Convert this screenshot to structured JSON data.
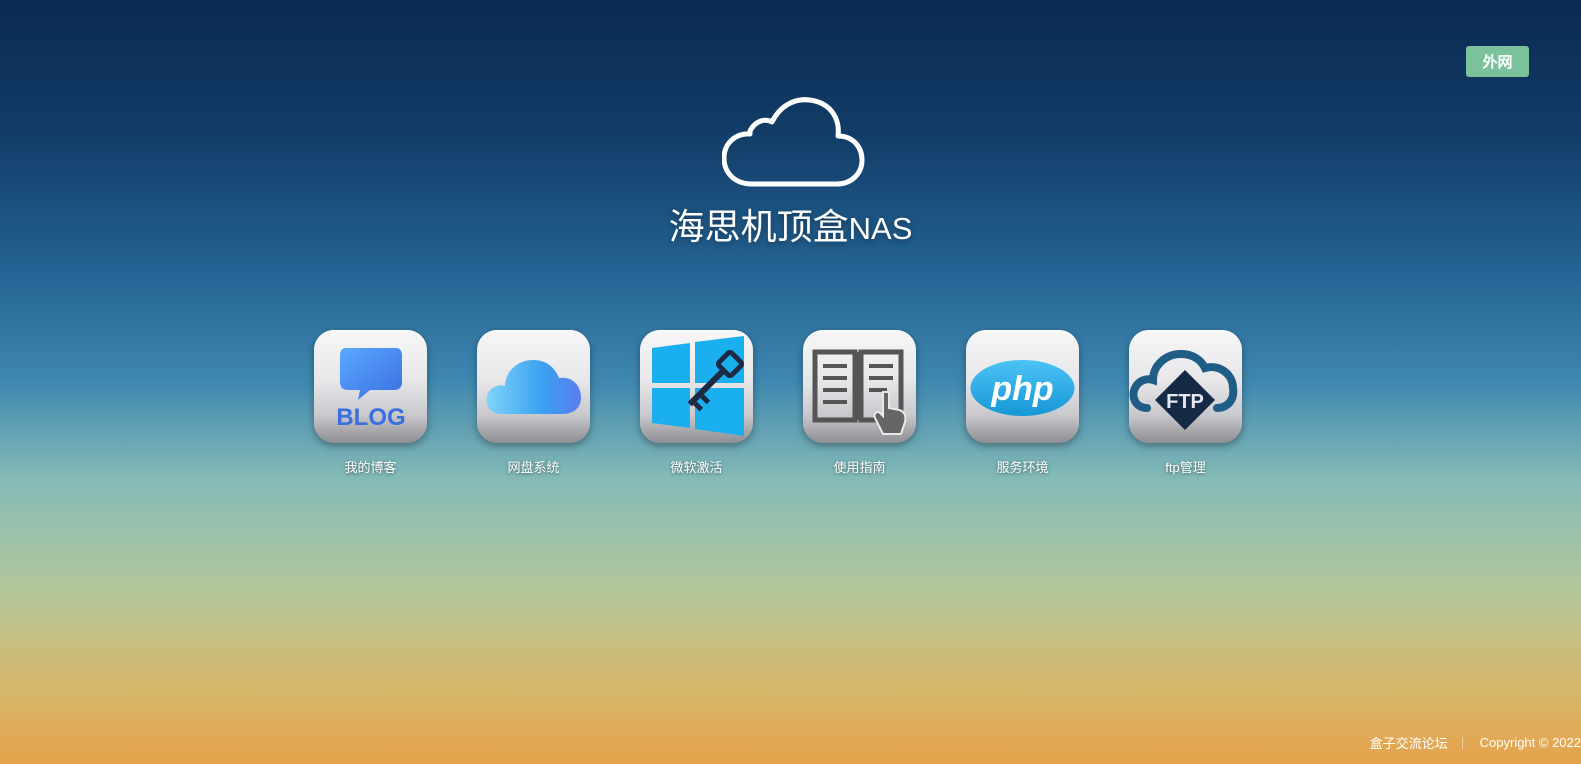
{
  "network_badge": "外网",
  "hero": {
    "icon": "cloud-outline-icon",
    "title_main": "海思机顶盒",
    "title_suffix": "NAS"
  },
  "apps": [
    {
      "label": "我的博客",
      "icon": "blog-icon",
      "icon_text": "BLOG"
    },
    {
      "label": "网盘系统",
      "icon": "icloud-icon"
    },
    {
      "label": "微软激活",
      "icon": "windows-key-icon"
    },
    {
      "label": "使用指南",
      "icon": "book-guide-icon"
    },
    {
      "label": "服务环境",
      "icon": "php-icon",
      "icon_text": "php"
    },
    {
      "label": "ftp管理",
      "icon": "ftp-cloud-icon",
      "icon_text": "FTP"
    }
  ],
  "footer": {
    "forum_link": "盒子交流论坛",
    "copyright": "Copyright © 2022"
  },
  "colors": {
    "badge": "#7bc29c",
    "gradient_top": "#0a2a52",
    "gradient_bottom": "#e6a24b"
  }
}
